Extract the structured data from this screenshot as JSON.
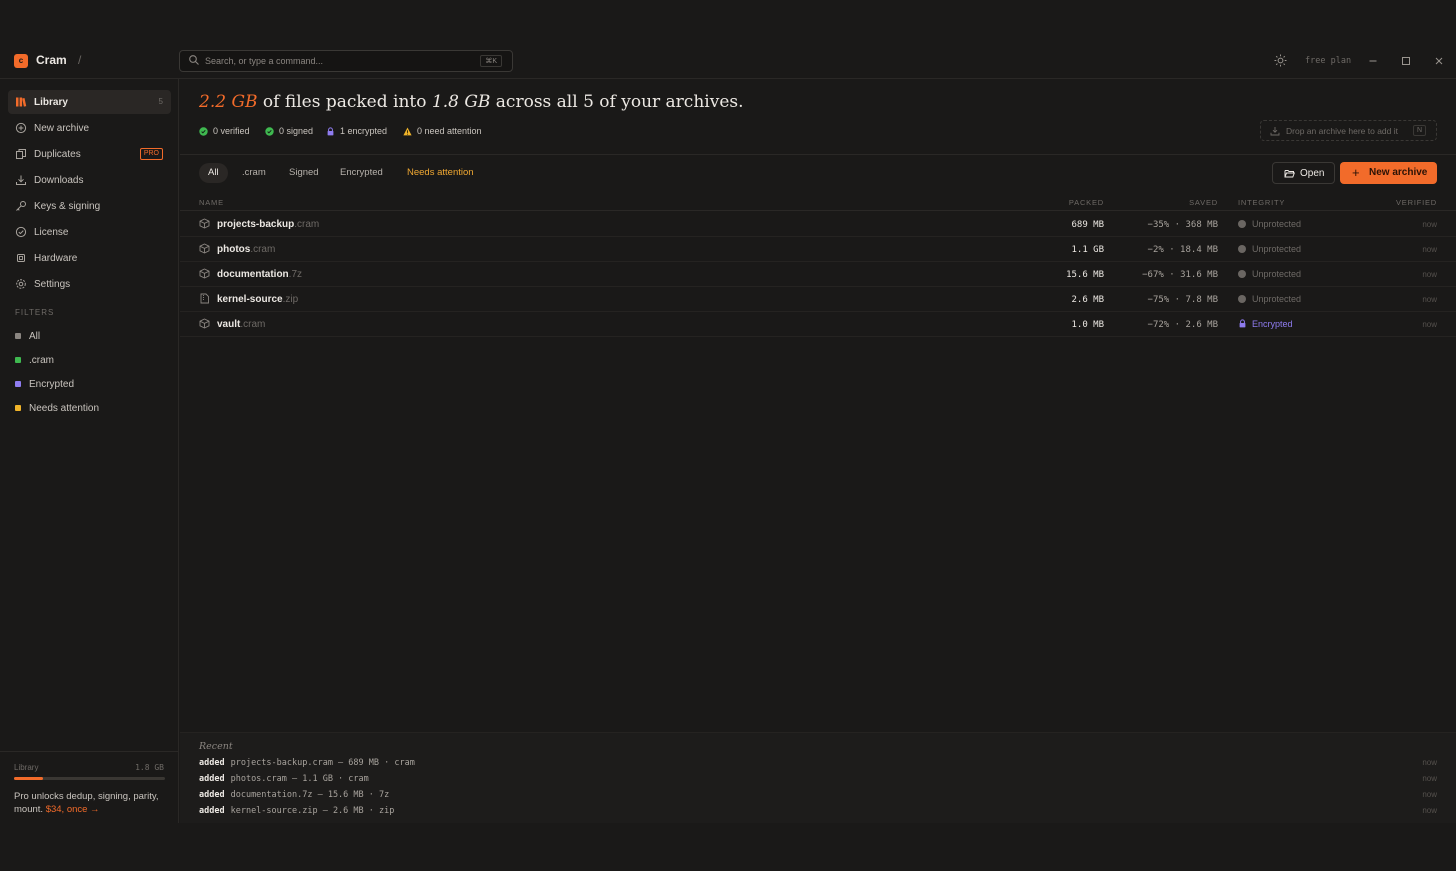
{
  "app": {
    "logo_letter": "c",
    "name": "Cram",
    "crumb_separator": "/",
    "plan": "free plan"
  },
  "search": {
    "placeholder": "Search, or type a command...",
    "shortcut": "⌘K"
  },
  "sidebar": {
    "items": [
      {
        "label": "Library",
        "count": "5",
        "icon": "library-icon",
        "active": true
      },
      {
        "label": "New archive",
        "icon": "plus-circle-icon"
      },
      {
        "label": "Duplicates",
        "icon": "duplicate-icon",
        "badge": "PRO"
      },
      {
        "label": "Downloads",
        "icon": "download-icon"
      },
      {
        "label": "Keys & signing",
        "icon": "key-icon"
      },
      {
        "label": "License",
        "icon": "check-circle-icon"
      },
      {
        "label": "Hardware",
        "icon": "chip-icon"
      },
      {
        "label": "Settings",
        "icon": "gear-icon"
      }
    ],
    "filters_heading": "FILTERS",
    "filters": [
      {
        "label": "All",
        "color": "#8a8580"
      },
      {
        "label": ".cram",
        "color": "#3fb950"
      },
      {
        "label": "Encrypted",
        "color": "#8f7cf0"
      },
      {
        "label": "Needs attention",
        "color": "#f0b429"
      }
    ],
    "footer": {
      "label": "Library",
      "size": "1.8 GB",
      "usage_fraction": 0.19,
      "promo_text": "Pro unlocks dedup, signing, parity, mount.",
      "promo_link": "$34, once →"
    }
  },
  "headline": {
    "total": "2.2 GB",
    "part1": "of files packed into",
    "packed": "1.8 GB",
    "part2": "across all 5 of your archives."
  },
  "stats": [
    {
      "text": "0 verified",
      "icon": "check-circle-icon",
      "color": "#3fb950"
    },
    {
      "text": "0 signed",
      "icon": "check-circle-icon",
      "color": "#3fb950"
    },
    {
      "text": "1 encrypted",
      "icon": "lock-icon",
      "color": "#8f7cf0"
    },
    {
      "text": "0 need attention",
      "icon": "warning-icon",
      "color": "#f0b429"
    }
  ],
  "drop_zone": {
    "text": "Drop an archive here to add it",
    "shortcut": "N"
  },
  "tabs": [
    "All",
    ".cram",
    "Signed",
    "Encrypted",
    "Needs attention"
  ],
  "actions": {
    "open": "Open",
    "new_archive": "New archive"
  },
  "table": {
    "headers": {
      "name": "NAME",
      "packed": "PACKED",
      "saved": "SAVED",
      "integrity": "INTEGRITY",
      "verified": "VERIFIED"
    },
    "rows": [
      {
        "name": "projects-backup",
        "ext": ".cram",
        "packed": "689 MB",
        "saved": "−35% · 368 MB",
        "integrity": "Unprotected",
        "verified": "now",
        "icon": "box-icon"
      },
      {
        "name": "photos",
        "ext": ".cram",
        "packed": "1.1 GB",
        "saved": "−2% · 18.4 MB",
        "integrity": "Unprotected",
        "verified": "now",
        "icon": "box-icon"
      },
      {
        "name": "documentation",
        "ext": ".7z",
        "packed": "15.6 MB",
        "saved": "−67% · 31.6 MB",
        "integrity": "Unprotected",
        "verified": "now",
        "icon": "box-icon"
      },
      {
        "name": "kernel-source",
        "ext": ".zip",
        "packed": "2.6 MB",
        "saved": "−75% · 7.8 MB",
        "integrity": "Unprotected",
        "verified": "now",
        "icon": "zip-file-icon"
      },
      {
        "name": "vault",
        "ext": ".cram",
        "packed": "1.0 MB",
        "saved": "−72% · 2.6 MB",
        "integrity": "Encrypted",
        "verified": "now",
        "icon": "box-icon"
      }
    ]
  },
  "recent": {
    "heading": "Recent",
    "items": [
      {
        "action": "added",
        "detail": "projects-backup.cram — 689 MB · cram",
        "time": "now"
      },
      {
        "action": "added",
        "detail": "photos.cram — 1.1 GB · cram",
        "time": "now"
      },
      {
        "action": "added",
        "detail": "documentation.7z — 15.6 MB · 7z",
        "time": "now"
      },
      {
        "action": "added",
        "detail": "kernel-source.zip — 2.6 MB · zip",
        "time": "now"
      }
    ]
  }
}
